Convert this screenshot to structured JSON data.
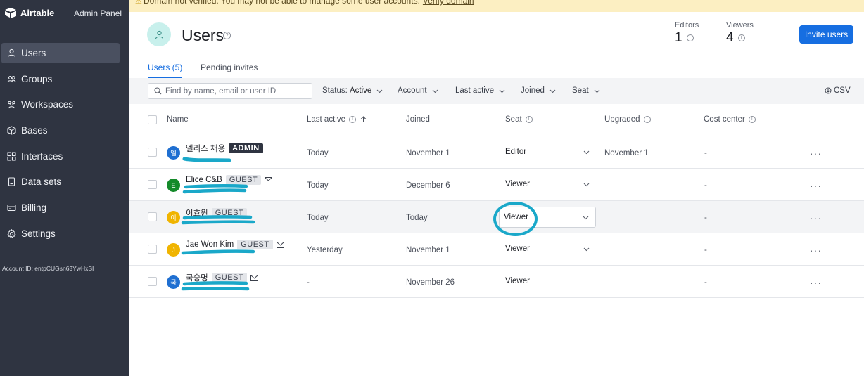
{
  "brand": {
    "name": "Airtable",
    "panel": "Admin Panel"
  },
  "banner": {
    "text": "Domain not verified. You may not be able to manage some user accounts.",
    "link": "Verify domain"
  },
  "sidebar": {
    "items": [
      {
        "label": "Users",
        "icon": "user-icon"
      },
      {
        "label": "Groups",
        "icon": "groups-icon"
      },
      {
        "label": "Workspaces",
        "icon": "workspaces-icon"
      },
      {
        "label": "Bases",
        "icon": "cube-icon"
      },
      {
        "label": "Interfaces",
        "icon": "grid-icon"
      },
      {
        "label": "Data sets",
        "icon": "document-icon"
      },
      {
        "label": "Billing",
        "icon": "card-icon"
      },
      {
        "label": "Settings",
        "icon": "gear-icon"
      }
    ],
    "account_id": "Account ID: entpCUGsn63YwHxSI"
  },
  "header": {
    "title": "Users",
    "help": "?",
    "editors_label": "Editors",
    "editors_value": "1",
    "viewers_label": "Viewers",
    "viewers_value": "4",
    "info": "i",
    "invite_label": "Invite users"
  },
  "tabs": [
    {
      "label": "Users (5)"
    },
    {
      "label": "Pending invites"
    }
  ],
  "filters": {
    "search_placeholder": "Find by name, email or user ID",
    "status_label": "Status:",
    "status_value": "Active",
    "account": "Account",
    "last_active": "Last active",
    "joined": "Joined",
    "seat": "Seat",
    "csv": "CSV"
  },
  "table": {
    "headers": {
      "name": "Name",
      "last_active": "Last active",
      "joined": "Joined",
      "seat": "Seat",
      "upgraded": "Upgraded",
      "cost_center": "Cost center"
    },
    "rows": [
      {
        "initial": "엘",
        "name": "엘리스 채용",
        "badge": "ADMIN",
        "last_active": "Today",
        "joined": "November 1",
        "seat": "Editor",
        "upgraded": "November 1",
        "cost_center": "-",
        "more": "···"
      },
      {
        "initial": "E",
        "name": "Elice C&B",
        "badge": "GUEST",
        "last_active": "Today",
        "joined": "December 6",
        "seat": "Viewer",
        "upgraded": "",
        "cost_center": "-",
        "more": "···"
      },
      {
        "initial": "이",
        "name": "이효원",
        "badge": "GUEST",
        "last_active": "Today",
        "joined": "Today",
        "seat": "Viewer",
        "upgraded": "",
        "cost_center": "-",
        "more": "···"
      },
      {
        "initial": "J",
        "name": "Jae Won Kim",
        "badge": "GUEST",
        "last_active": "Yesterday",
        "joined": "November 1",
        "seat": "Viewer",
        "upgraded": "",
        "cost_center": "-",
        "more": "···"
      },
      {
        "initial": "국",
        "name": "국승명",
        "badge": "GUEST",
        "last_active": "-",
        "joined": "November 26",
        "seat": "Viewer",
        "upgraded": "",
        "cost_center": "-",
        "more": "···"
      }
    ]
  },
  "colors": {
    "sidebar_bg": "#2f3441",
    "accent": "#166ee1",
    "annotation": "#1aa8c9",
    "banner_bg": "#fcefc2"
  }
}
